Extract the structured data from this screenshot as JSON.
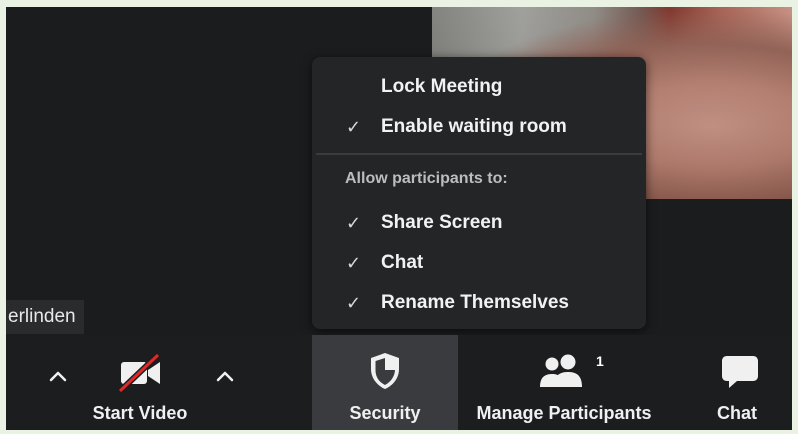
{
  "participant_name": "erlinden",
  "security_menu": {
    "items": [
      {
        "label": "Lock Meeting",
        "checked": false
      },
      {
        "label": "Enable waiting room",
        "checked": true
      }
    ],
    "section_title": "Allow participants to:",
    "allow_items": [
      {
        "label": "Share Screen",
        "checked": true
      },
      {
        "label": "Chat",
        "checked": true
      },
      {
        "label": "Rename Themselves",
        "checked": true
      }
    ],
    "check_glyph": "✓"
  },
  "toolbar": {
    "start_video": "Start Video",
    "security": "Security",
    "manage_participants": "Manage Participants",
    "participants_count": "1",
    "chat": "Chat"
  },
  "colors": {
    "background": "#1b1c1e",
    "menu": "#242527",
    "active_button": "#3a3b3e",
    "video_off_red": "#e02828"
  },
  "icons": [
    "caret-up-icon",
    "video-off-icon",
    "shield-icon",
    "participants-icon",
    "chat-icon",
    "checkmark-icon"
  ]
}
